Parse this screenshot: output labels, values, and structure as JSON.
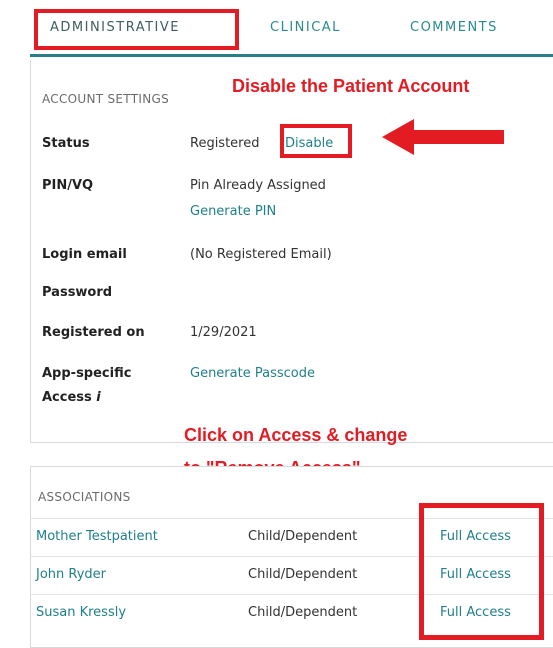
{
  "tabs": {
    "administrative": "ADMINISTRATIVE",
    "clinical": "CLINICAL",
    "comments": "COMMENTS"
  },
  "account": {
    "section_title": "ACCOUNT SETTINGS",
    "status_label": "Status",
    "status_value": "Registered",
    "status_link": "Disable",
    "pin_label": "PIN/VQ",
    "pin_value": "Pin Already Assigned",
    "pin_link": "Generate PIN",
    "email_label": "Login email",
    "email_value": "(No Registered Email)",
    "password_label": "Password",
    "registered_label": "Registered on",
    "registered_value": "1/29/2021",
    "app_label_line1": "App-specific",
    "app_label_line2": "Access",
    "app_info_icon": "i",
    "app_link": "Generate Passcode"
  },
  "annotations": {
    "disable_text": "Disable the Patient Account",
    "access_line1": "Click on Access & change",
    "access_line2": "to \"Remove Access\"",
    "color": "#e31b23"
  },
  "associations": {
    "section_title": "ASSOCIATIONS",
    "rows": [
      {
        "name": "Mother Testpatient",
        "relationship": "Child/Dependent",
        "access": "Full Access"
      },
      {
        "name": "John Ryder",
        "relationship": "Child/Dependent",
        "access": "Full Access"
      },
      {
        "name": "Susan Kressly",
        "relationship": "Child/Dependent",
        "access": "Full Access"
      }
    ]
  },
  "colors": {
    "accent": "#1f7f8a",
    "tab_underline": "#2a7f86",
    "annotation": "#e31b23"
  }
}
